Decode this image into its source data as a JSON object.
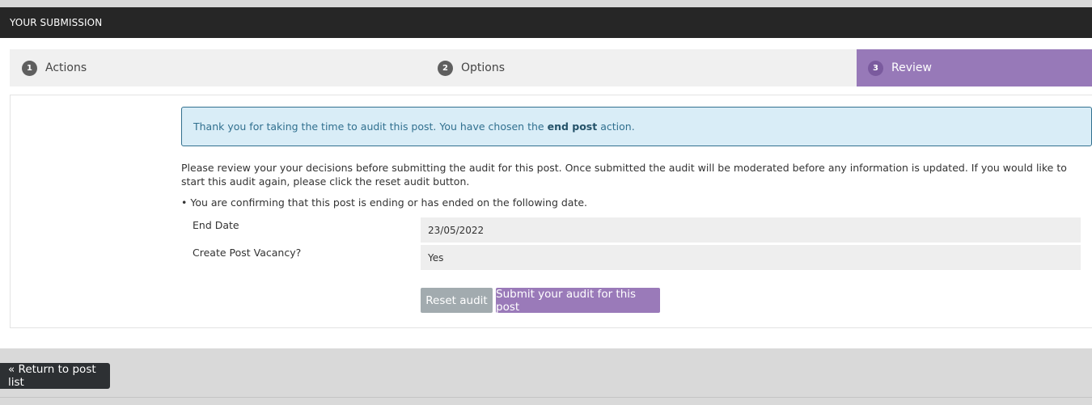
{
  "header": {
    "title": "YOUR SUBMISSION"
  },
  "steps": [
    {
      "number": "1",
      "label": "Actions"
    },
    {
      "number": "2",
      "label": "Options"
    },
    {
      "number": "3",
      "label": "Review"
    }
  ],
  "active_step": "Review",
  "alert": {
    "text_before": "Thank you for taking the time to audit this post. You have chosen the",
    "bold": "end post",
    "text_after": "action."
  },
  "intro": "Please review your your decisions before submitting the audit for this post. Once submitted the audit will be moderated before any information is updated. If you would like to start this audit again, please click the reset audit button.",
  "confirm_text": "• You are confirming that this post is ending or has ended on the following date.",
  "summary": [
    {
      "label": "End Date",
      "value": "23/05/2022"
    },
    {
      "label": "Create Post Vacancy?",
      "value": "Yes"
    }
  ],
  "buttons": {
    "reset": "Reset audit",
    "submit": "Submit your audit for this post"
  },
  "footer": {
    "back_link": "« Return to post list"
  },
  "colors": {
    "accent": "#9779b8",
    "header_bg": "#262626",
    "alert_bg": "#d9edf7",
    "reset_button": "#a2abaf"
  }
}
